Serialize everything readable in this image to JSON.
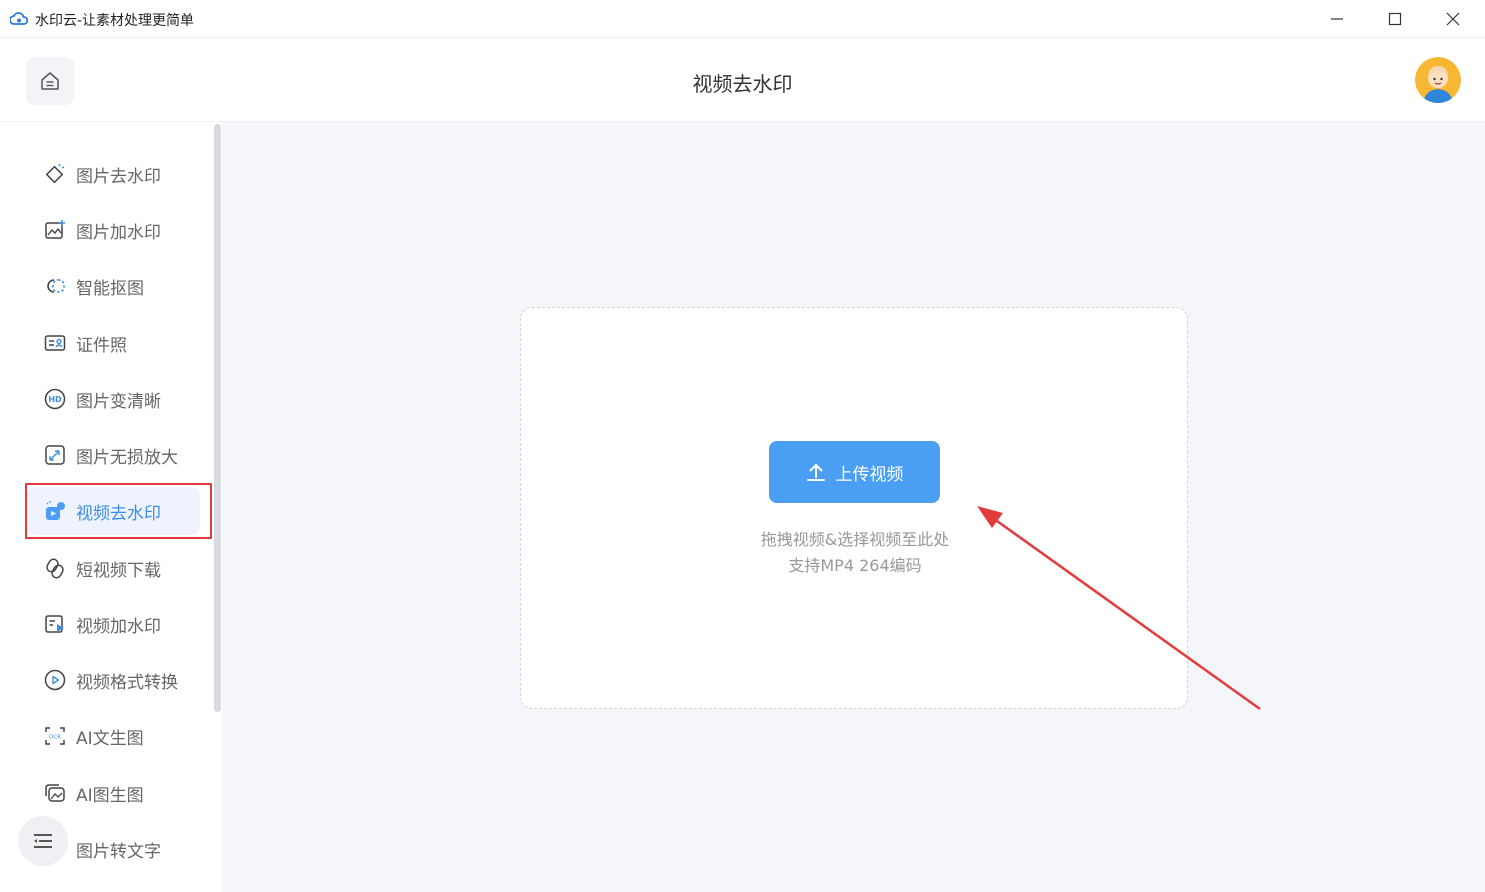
{
  "window": {
    "title": "水印云-让素材处理更简单"
  },
  "header": {
    "page_title": "视频去水印"
  },
  "sidebar": {
    "items": [
      {
        "label": "图片去水印",
        "icon": "eraser-icon"
      },
      {
        "label": "图片加水印",
        "icon": "image-add-icon"
      },
      {
        "label": "智能抠图",
        "icon": "cutout-icon"
      },
      {
        "label": "证件照",
        "icon": "id-card-icon"
      },
      {
        "label": "图片变清晰",
        "icon": "hd-icon"
      },
      {
        "label": "图片无损放大",
        "icon": "enlarge-icon"
      },
      {
        "label": "视频去水印",
        "icon": "video-erase-icon",
        "active": true
      },
      {
        "label": "短视频下载",
        "icon": "link-icon"
      },
      {
        "label": "视频加水印",
        "icon": "video-add-icon"
      },
      {
        "label": "视频格式转换",
        "icon": "play-circle-icon"
      },
      {
        "label": "AI文生图",
        "icon": "ocr-scan-icon"
      },
      {
        "label": "AI图生图",
        "icon": "image-stack-icon"
      },
      {
        "label": "图片转文字",
        "icon": "text-icon"
      }
    ]
  },
  "upload": {
    "button_label": "上传视频",
    "hint_line1": "拖拽视频&选择视频至此处",
    "hint_line2": "支持MP4 264编码"
  },
  "colors": {
    "accent": "#4a9ff5",
    "active_text": "#3a8ee6",
    "highlight_border": "#e23b3b",
    "annotation_arrow": "#e23b3b",
    "main_bg": "#f4f6fa"
  }
}
